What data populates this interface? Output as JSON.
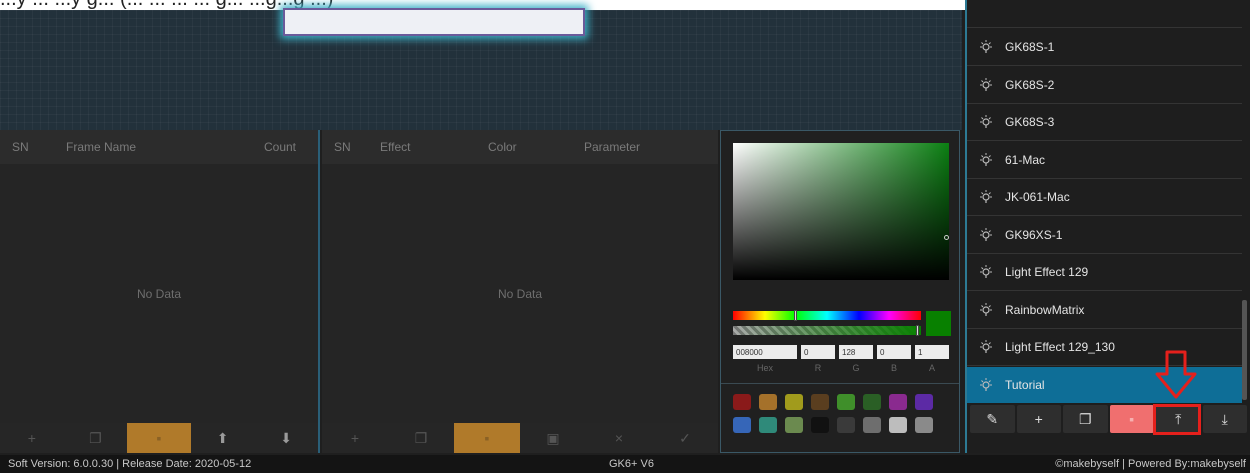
{
  "caption_text": "...y ... ...y g...  (... ... ... ... g... ...g...g ...)",
  "frame_table": {
    "columns": [
      "SN",
      "Frame Name",
      "Count"
    ],
    "empty_text": "No Data"
  },
  "effect_table": {
    "columns": [
      "SN",
      "Effect",
      "Color",
      "Parameter"
    ],
    "empty_text": "No Data"
  },
  "color_picker": {
    "hex": "008000",
    "r": "0",
    "g": "128",
    "b": "0",
    "a": "1",
    "labels": {
      "hex": "Hex",
      "r": "R",
      "g": "G",
      "b": "B",
      "a": "A"
    },
    "current_color": "#088000",
    "preset_colors": [
      "#8a1a1a",
      "#a5712a",
      "#a19b1c",
      "#5a3e1f",
      "#3f8f2a",
      "#2a5f25",
      "#8a2a8f",
      "#5c2aa5",
      "#3666b8",
      "#2f8a7a",
      "#6b8a4f",
      "#111111",
      "#3a3a3a",
      "#6e6e6e",
      "#bdbdbd",
      "#8a8a8a"
    ]
  },
  "lighting_list": {
    "items": [
      {
        "label": "GK68S-1",
        "selected": false
      },
      {
        "label": "GK68S-2",
        "selected": false
      },
      {
        "label": "GK68S-3",
        "selected": false
      },
      {
        "label": "61-Mac",
        "selected": false
      },
      {
        "label": "JK-061-Mac",
        "selected": false
      },
      {
        "label": "GK96XS-1",
        "selected": false
      },
      {
        "label": "Light Effect 129",
        "selected": false
      },
      {
        "label": "RainbowMatrix",
        "selected": false
      },
      {
        "label": "Light Effect 129_130",
        "selected": false
      },
      {
        "label": "Tutorial",
        "selected": true
      }
    ],
    "toolbar_icons": [
      "edit-icon",
      "add-icon",
      "copy-icon",
      "delete-icon",
      "upload-icon",
      "download-icon"
    ]
  },
  "status_bar": {
    "left": "Soft Version: 6.0.0.30 |  Release Date: 2020-05-12",
    "center": "GK6+ V6",
    "right": "©makebyself |  Powered By:makebyself"
  },
  "accent_colors": {
    "selected": "#0e6e97",
    "highlight": "#e5201c",
    "orange": "#b07a2a",
    "delete": "#f06f6f"
  }
}
